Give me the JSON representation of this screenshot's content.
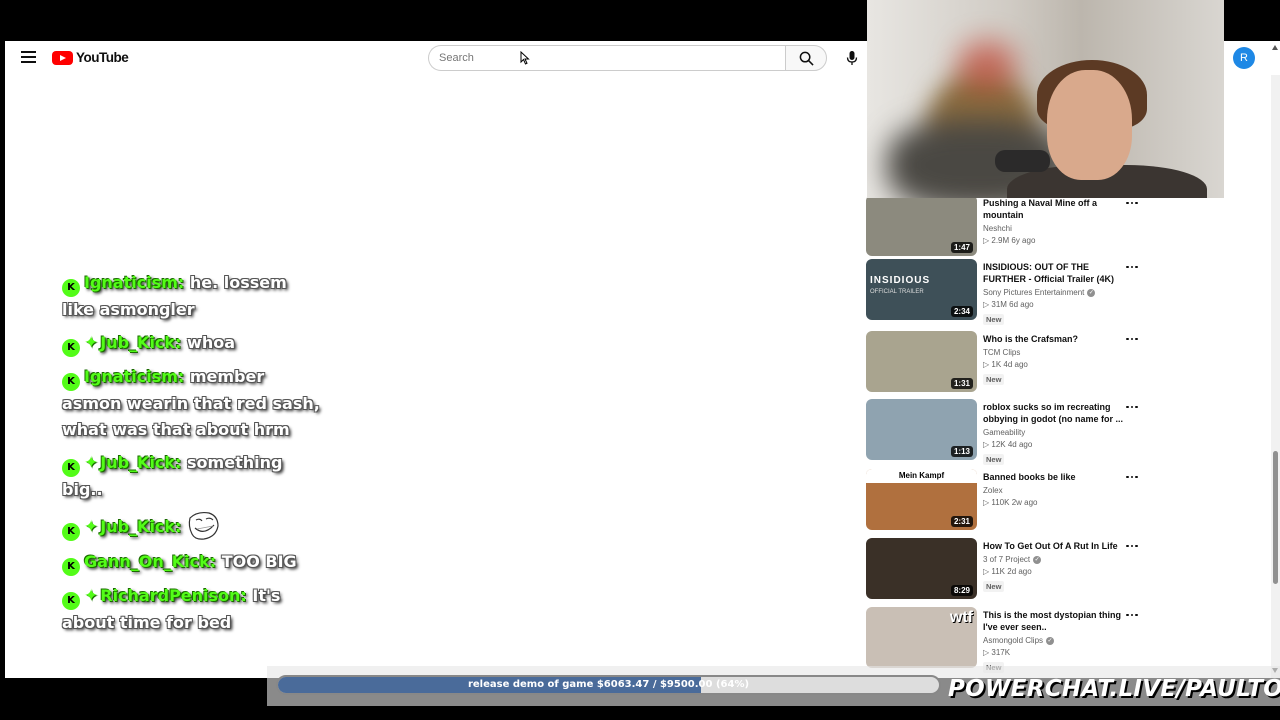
{
  "header": {
    "logo_text": "YouTube",
    "search_placeholder": "Search",
    "avatar_letter": "R"
  },
  "related": [
    {
      "title": "Pushing a Naval Mine off a mountain",
      "channel": "Neshchi",
      "verified": false,
      "views": "2.9M",
      "age": "6y ago",
      "duration": "1:47",
      "new": false,
      "thumb_color": "#8c8a7e"
    },
    {
      "title": "INSIDIOUS: OUT OF THE FURTHER - Official Trailer (4K)",
      "channel": "Sony Pictures Entertainment",
      "verified": true,
      "views": "31M",
      "age": "6d ago",
      "duration": "2:34",
      "new": true,
      "thumb_color": "#3e5058"
    },
    {
      "title": "Who is the Crafsman?",
      "channel": "TCM Clips",
      "verified": false,
      "views": "1K",
      "age": "4d ago",
      "duration": "1:31",
      "new": true,
      "thumb_color": "#a9a48f"
    },
    {
      "title": "roblox sucks so im recreating obbying in godot (no name for ...",
      "channel": "Gameability",
      "verified": false,
      "views": "12K",
      "age": "4d ago",
      "duration": "1:13",
      "new": true,
      "thumb_color": "#8fa3b0"
    },
    {
      "title": "Banned books be like",
      "channel": "Zolex",
      "verified": false,
      "views": "110K",
      "age": "2w ago",
      "duration": "2:31",
      "new": false,
      "thumb_color": "#b0703e"
    },
    {
      "title": "How To Get Out Of A Rut In Life",
      "channel": "3 of 7 Project",
      "verified": true,
      "views": "11K",
      "age": "2d ago",
      "duration": "8:29",
      "new": true,
      "thumb_color": "#3a3027"
    },
    {
      "title": "This is the most dystopian thing I've ever seen..",
      "channel": "Asmongold Clips",
      "verified": true,
      "views": "317K",
      "age": "",
      "duration": "",
      "new": true,
      "thumb_color": "#c9bfb5"
    }
  ],
  "thumb_overlays": {
    "insidious": "INSIDIOUS",
    "insidious_sub": "OFFICIAL TRAILER",
    "banned": "Mein Kampf",
    "dystopian": "wtf"
  },
  "chat": [
    {
      "user": "Ignaticism",
      "sub": false,
      "text": "he. lossem like asmongler"
    },
    {
      "user": "Jub_Kick",
      "sub": true,
      "text": "whoa"
    },
    {
      "user": "Ignaticism",
      "sub": false,
      "text": "member asmon wearin that red sash, what was that about hrm"
    },
    {
      "user": "Jub_Kick",
      "sub": true,
      "text": "something big.."
    },
    {
      "user": "Jub_Kick",
      "sub": true,
      "text": "",
      "emote": "trollface"
    },
    {
      "user": "Gann_On_Kick",
      "sub": false,
      "text": "TOO BIG"
    },
    {
      "user": "RichardPenison",
      "sub": true,
      "text": "It's about time for bed"
    }
  ],
  "goal": {
    "text": "release demo of game $6063.47 / $9500.00 (64%)",
    "fraction": 0.64
  },
  "brand": "POWERCHAT.LIVE/PAULTOWN",
  "colors": {
    "kick_green": "#53fc18",
    "yt_red": "#ff0000",
    "goal_fill": "#4a6b9a"
  }
}
